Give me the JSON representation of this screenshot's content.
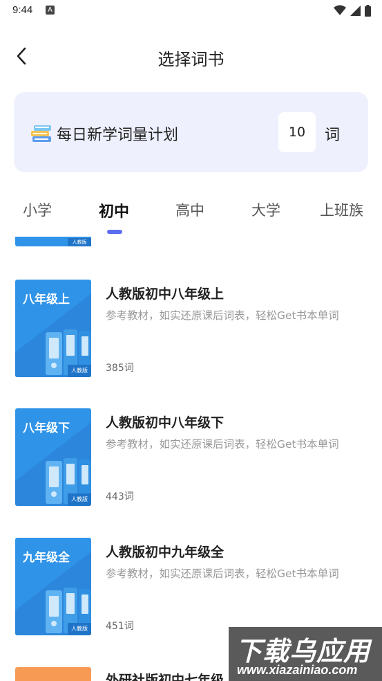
{
  "status_bar": {
    "time": "9:44",
    "notification_badge": "A"
  },
  "header": {
    "title": "选择词书"
  },
  "plan": {
    "label": "每日新学词量计划",
    "count": "10",
    "unit": "词"
  },
  "tabs": [
    {
      "label": "小学",
      "active": false
    },
    {
      "label": "初中",
      "active": true
    },
    {
      "label": "高中",
      "active": false
    },
    {
      "label": "大学",
      "active": false
    },
    {
      "label": "上班族",
      "active": false
    }
  ],
  "books": [
    {
      "cover_title": "八年级上",
      "publisher_badge": "人教版",
      "title": "人教版初中八年级上",
      "desc": "参考教材，如实还原课后词表，轻松Get书本单词",
      "count": "385词"
    },
    {
      "cover_title": "八年级下",
      "publisher_badge": "人教版",
      "title": "人教版初中八年级下",
      "desc": "参考教材，如实还原课后词表，轻松Get书本单词",
      "count": "443词"
    },
    {
      "cover_title": "九年级全",
      "publisher_badge": "人教版",
      "title": "人教版初中九年级全",
      "desc": "参考教材，如实还原课后词表，轻松Get书本单词",
      "count": "451词"
    },
    {
      "title": "外研社版初中七年级上"
    }
  ],
  "partial_top_badge": "人教版",
  "watermark": {
    "main": "下载乌应用",
    "sub": "www.xiazainiao.com"
  },
  "colors": {
    "accent": "#5b6ef0",
    "plan_bg": "#eef1fd",
    "cover_blue": "#2f93e8",
    "cover_orange": "#f79a54"
  }
}
